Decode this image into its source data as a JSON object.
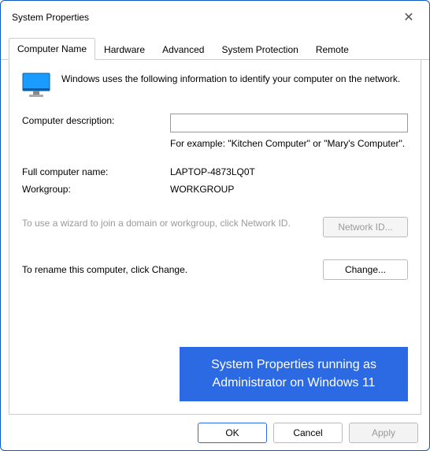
{
  "window": {
    "title": "System Properties"
  },
  "tabs": {
    "computer_name": "Computer Name",
    "hardware": "Hardware",
    "advanced": "Advanced",
    "system_protection": "System Protection",
    "remote": "Remote"
  },
  "intro": "Windows uses the following information to identify your computer on the network.",
  "fields": {
    "description_label": "Computer description:",
    "description_value": "",
    "example_text": "For example: \"Kitchen Computer\" or \"Mary's Computer\".",
    "full_name_label": "Full computer name:",
    "full_name_value": "LAPTOP-4873LQ0T",
    "workgroup_label": "Workgroup:",
    "workgroup_value": "WORKGROUP"
  },
  "wizard": {
    "text": "To use a wizard to join a domain or workgroup, click Network ID.",
    "button": "Network ID..."
  },
  "change": {
    "text": "To rename this computer, click Change.",
    "button": "Change..."
  },
  "caption": "System Properties running as Administrator on Windows 11",
  "buttons": {
    "ok": "OK",
    "cancel": "Cancel",
    "apply": "Apply"
  }
}
